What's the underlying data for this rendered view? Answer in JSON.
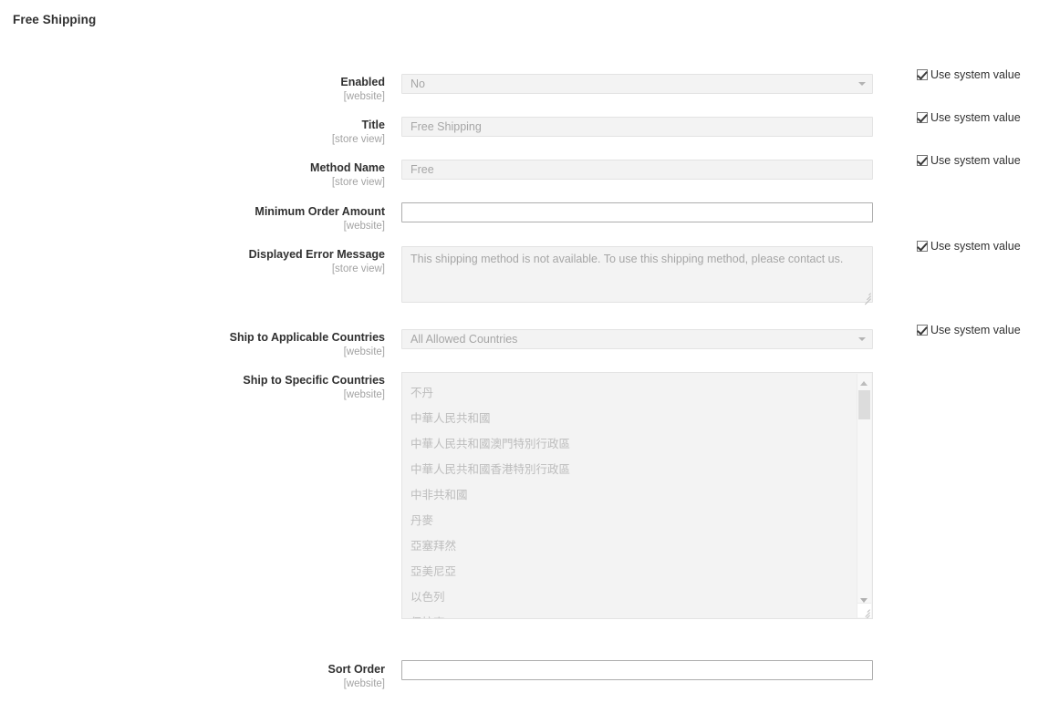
{
  "page": {
    "title": "Free Shipping"
  },
  "common": {
    "use_system_value": "Use system value",
    "scope_website": "[website]",
    "scope_store_view": "[store view]"
  },
  "fields": {
    "enabled": {
      "label": "Enabled",
      "scope": "[website]",
      "value": "No",
      "use_system_value": "Use system value"
    },
    "title": {
      "label": "Title",
      "scope": "[store view]",
      "value": "Free Shipping",
      "use_system_value": "Use system value"
    },
    "method_name": {
      "label": "Method Name",
      "scope": "[store view]",
      "value": "Free",
      "use_system_value": "Use system value"
    },
    "minimum_order_amount": {
      "label": "Minimum Order Amount",
      "scope": "[website]",
      "value": ""
    },
    "displayed_error_message": {
      "label": "Displayed Error Message",
      "scope": "[store view]",
      "value": "This shipping method is not available. To use this shipping method, please contact us.",
      "use_system_value": "Use system value"
    },
    "ship_to_applicable_countries": {
      "label": "Ship to Applicable Countries",
      "scope": "[website]",
      "value": "All Allowed Countries",
      "use_system_value": "Use system value"
    },
    "ship_to_specific_countries": {
      "label": "Ship to Specific Countries",
      "scope": "[website]",
      "options": [
        "不丹",
        "中華人民共和國",
        "中華人民共和國澳門特別行政區",
        "中華人民共和國香港特別行政區",
        "中非共和國",
        "丹麥",
        "亞塞拜然",
        "亞美尼亞",
        "以色列",
        "伊拉克"
      ]
    },
    "sort_order": {
      "label": "Sort Order",
      "scope": "[website]",
      "value": ""
    }
  },
  "colors": {
    "text": "#303030",
    "scope_text": "#a3a3a3",
    "disabled_bg": "#f3f3f3",
    "disabled_text": "#a6a6a6",
    "enabled_border": "#adadad"
  }
}
